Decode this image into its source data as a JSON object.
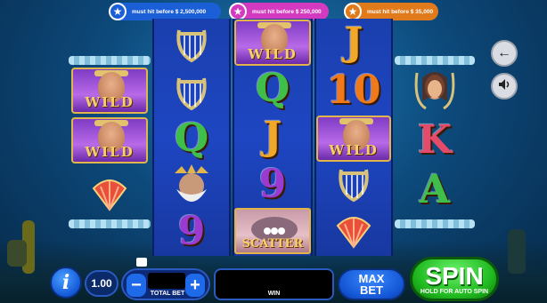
{
  "jackpots": [
    {
      "text": "must hit before $ 2,500,000",
      "color": "#1b5fd6",
      "star_color": "#1b5fd6"
    },
    {
      "text": "must hit before $ 250,000",
      "color": "#d43ac0",
      "star_color": "#d43ac0"
    },
    {
      "text": "must hit before $ 35,000",
      "color": "#e07a1a",
      "star_color": "#e07a1a"
    }
  ],
  "symbols": {
    "wild": "WILD",
    "scatter": "SCATTER",
    "letter_j": "J",
    "letter_q": "Q",
    "letter_k": "K",
    "letter_a": "A",
    "ten": "10",
    "nine": "9"
  },
  "side_buttons": {
    "back_icon": "←",
    "sound_icon": "🔊"
  },
  "controls": {
    "info_label": "i",
    "coin_value": "1.00",
    "bet_minus": "−",
    "bet_plus": "+",
    "bet_value": "",
    "total_bet_label": "TOTAL BET",
    "win_label": "WIN",
    "win_value": "",
    "max_bet_line1": "MAX",
    "max_bet_line2": "BET",
    "spin_label": "SPIN",
    "spin_sub": "HOLD FOR AUTO SPIN"
  }
}
